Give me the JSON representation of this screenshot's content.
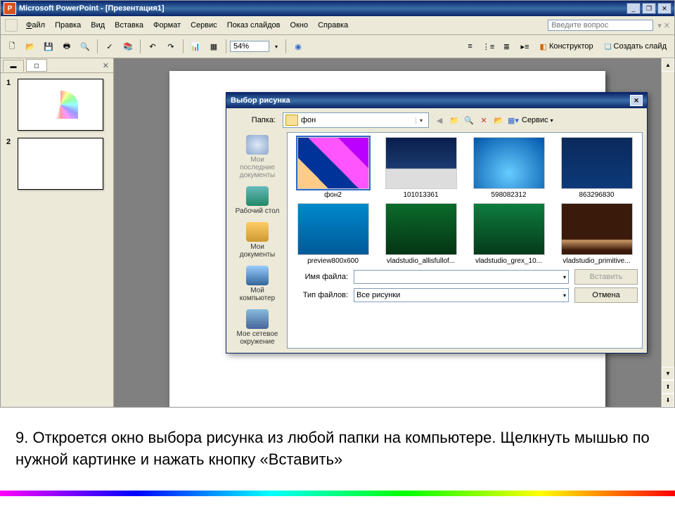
{
  "titlebar": {
    "app": "Microsoft PowerPoint",
    "doc": "[Презентация1]"
  },
  "menu": {
    "file": "Файл",
    "edit": "Правка",
    "view": "Вид",
    "insert": "Вставка",
    "format": "Формат",
    "tools": "Сервис",
    "slideshow": "Показ слайдов",
    "window": "Окно",
    "help": "Справка",
    "search_ph": "Введите вопрос"
  },
  "toolbar": {
    "zoom": "54%",
    "designer": "Конструктор",
    "newslide": "Создать слайд"
  },
  "thumbs": {
    "s1": "1",
    "s2": "2"
  },
  "dialog": {
    "title": "Выбор рисунка",
    "folder_label": "Папка:",
    "folder": "фон",
    "service": "Сервис",
    "places": {
      "recent": "Мои последние документы",
      "desktop": "Рабочий стол",
      "mydocs": "Мои документы",
      "mycomp": "Мой компьютер",
      "network": "Мое сетевое окружение"
    },
    "files": {
      "f1": "фон2",
      "f2": "101013361",
      "f3": "598082312",
      "f4": "863296830",
      "f5": "preview800x600",
      "f6": "vladstudio_allisfullof...",
      "f7": "vladstudio_grex_10...",
      "f8": "vladstudio_primitive..."
    },
    "filename_label": "Имя файла:",
    "filetype_label": "Тип файлов:",
    "filetype_value": "Все рисунки",
    "insert_btn": "Вставить",
    "cancel_btn": "Отмена"
  },
  "caption": "9.   Откроется окно выбора рисунка из любой папки на компьютере. Щелкнуть мышью по нужной картинке и нажать кнопку «Вставить»"
}
